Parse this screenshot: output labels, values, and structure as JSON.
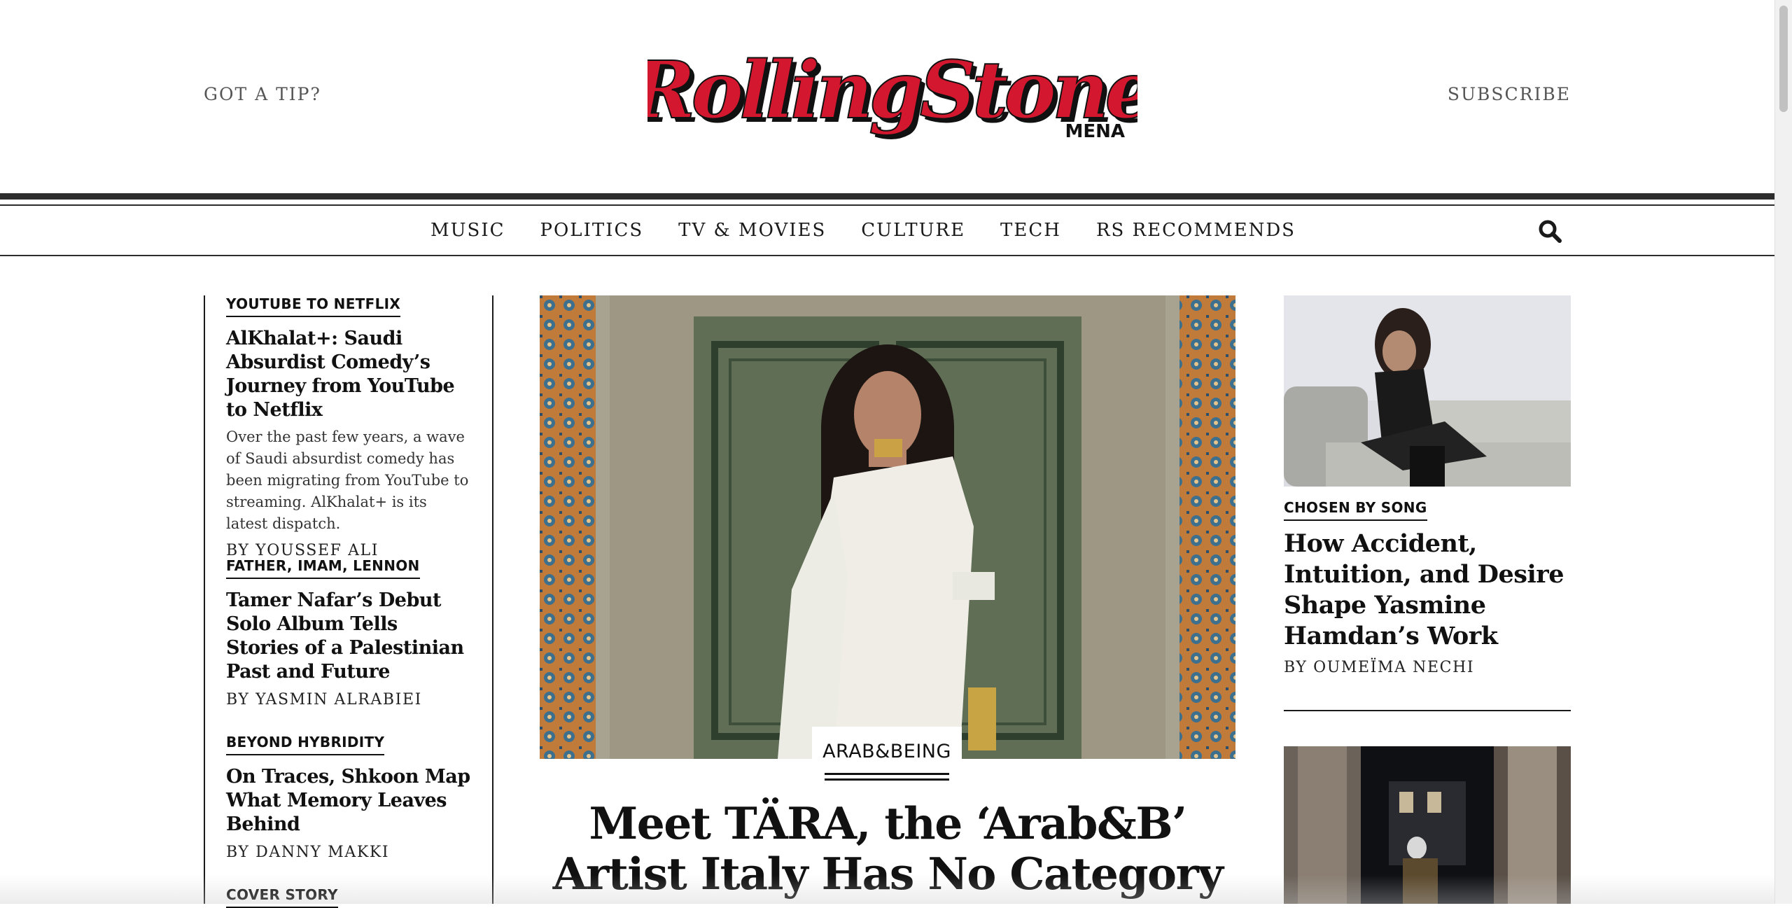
{
  "header": {
    "tip_label": "GOT A TIP?",
    "subscribe_label": "SUBSCRIBE",
    "logo_text": "RollingStone",
    "logo_sub": "MENA",
    "brand_color": "#d3172e"
  },
  "nav": {
    "items": [
      "MUSIC",
      "POLITICS",
      "TV & MOVIES",
      "CULTURE",
      "TECH",
      "RS RECOMMENDS"
    ]
  },
  "left": {
    "stories": [
      {
        "kicker": "YOUTUBE TO NETFLIX",
        "title": "AlKhalat+: Saudi Absurdist Comedy’s Journey from YouTube to Netflix",
        "dek": "Over the past few years, a wave of Saudi absurdist comedy has been migrating from YouTube to streaming. AlKhalat+ is its latest dispatch.",
        "byline": "BY YOUSSEF ALI"
      },
      {
        "kicker": "FATHER, IMAM, LENNON",
        "title": "Tamer Nafar’s Debut Solo Album Tells Stories of a Palestinian Past and Future",
        "byline": "BY YASMIN ALRABIEI"
      },
      {
        "kicker": "BEYOND HYBRIDITY",
        "title": "On Traces, Shkoon Map What Memory Leaves Behind",
        "byline": "BY DANNY MAKKI"
      },
      {
        "kicker": "COVER STORY"
      }
    ]
  },
  "hero": {
    "tag": "ARAB&BEING",
    "title": "Meet TÄRA, the ‘Arab&B’ Artist Italy Has No Category"
  },
  "right": {
    "story1": {
      "kicker": "CHOSEN BY SONG",
      "title": "How Accident, Intuition, and Desire Shape Yasmine Hamdan’s Work",
      "byline": "BY OUMEÏMA NECHI"
    }
  }
}
